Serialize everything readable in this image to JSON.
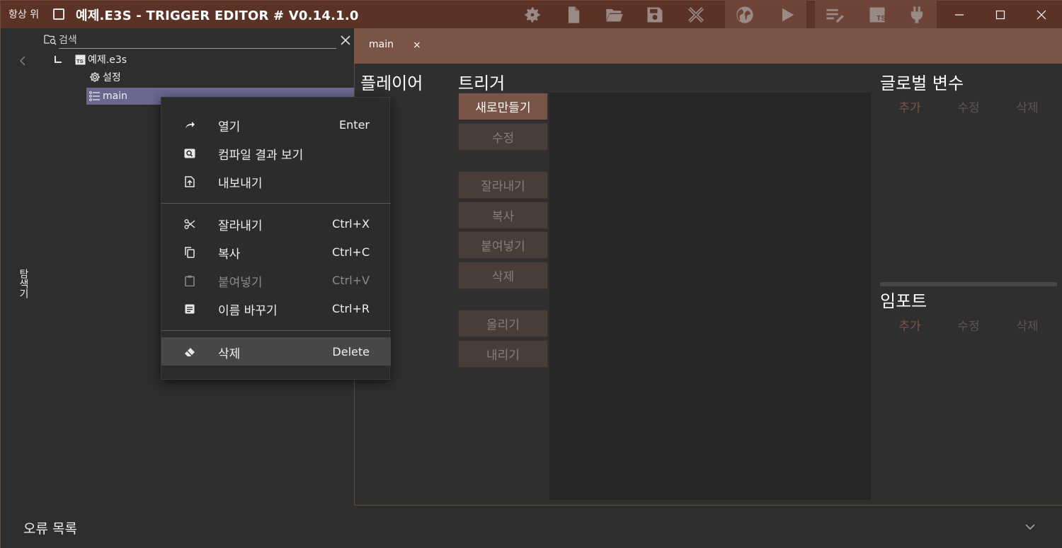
{
  "titlebar": {
    "always_on_top": "항상 위",
    "title": "예제.E3S - TRIGGER EDITOR # V0.14.1.0",
    "toolbar_icons": [
      "settings-icon",
      "new-file-icon",
      "open-folder-icon",
      "save-icon",
      "close-tools-icon",
      "globe-icon",
      "play-icon",
      "edit-list-icon",
      "typescript-icon",
      "plugin-icon"
    ],
    "window_controls": [
      "minimize",
      "maximize",
      "close"
    ]
  },
  "explorer": {
    "search_placeholder": "검색",
    "side_tab_label": "탐색기",
    "tree": [
      {
        "label": "예제.e3s",
        "icon": "ts-file-icon"
      },
      {
        "label": "설정",
        "icon": "gear-icon"
      },
      {
        "label": "main",
        "icon": "list-icon",
        "selected": true
      }
    ]
  },
  "document": {
    "tab_label": "main",
    "tab_close": "×",
    "player_title": "플레이어",
    "trigger_title": "트리거",
    "trigger_buttons": [
      {
        "label": "새로만들기",
        "primary": true
      },
      {
        "label": "수정"
      },
      {
        "label": "잘라내기"
      },
      {
        "label": "복사"
      },
      {
        "label": "붙여넣기"
      },
      {
        "label": "삭제"
      },
      {
        "label": "올리기"
      },
      {
        "label": "내리기"
      }
    ],
    "global_vars_title": "글로벌 변수",
    "global_vars_buttons": [
      "추가",
      "수정",
      "삭제"
    ],
    "import_title": "임포트",
    "import_buttons": [
      "추가",
      "수정",
      "삭제"
    ]
  },
  "error_list": {
    "title": "오류 목록"
  },
  "context_menu": {
    "items": [
      {
        "label": "열기",
        "shortcut": "Enter",
        "icon": "open-arrow-icon"
      },
      {
        "label": "컴파일 결과 보기",
        "shortcut": "",
        "icon": "search-box-icon"
      },
      {
        "label": "내보내기",
        "shortcut": "",
        "icon": "export-file-icon"
      },
      {
        "label": "잘라내기",
        "shortcut": "Ctrl+X",
        "icon": "scissors-icon"
      },
      {
        "label": "복사",
        "shortcut": "Ctrl+C",
        "icon": "copy-icon"
      },
      {
        "label": "붙여넣기",
        "shortcut": "Ctrl+V",
        "icon": "clipboard-icon",
        "disabled": true
      },
      {
        "label": "이름 바꾸기",
        "shortcut": "Ctrl+R",
        "icon": "rename-icon"
      },
      {
        "label": "삭제",
        "shortcut": "Delete",
        "icon": "eraser-icon",
        "highlighted": true
      }
    ]
  }
}
